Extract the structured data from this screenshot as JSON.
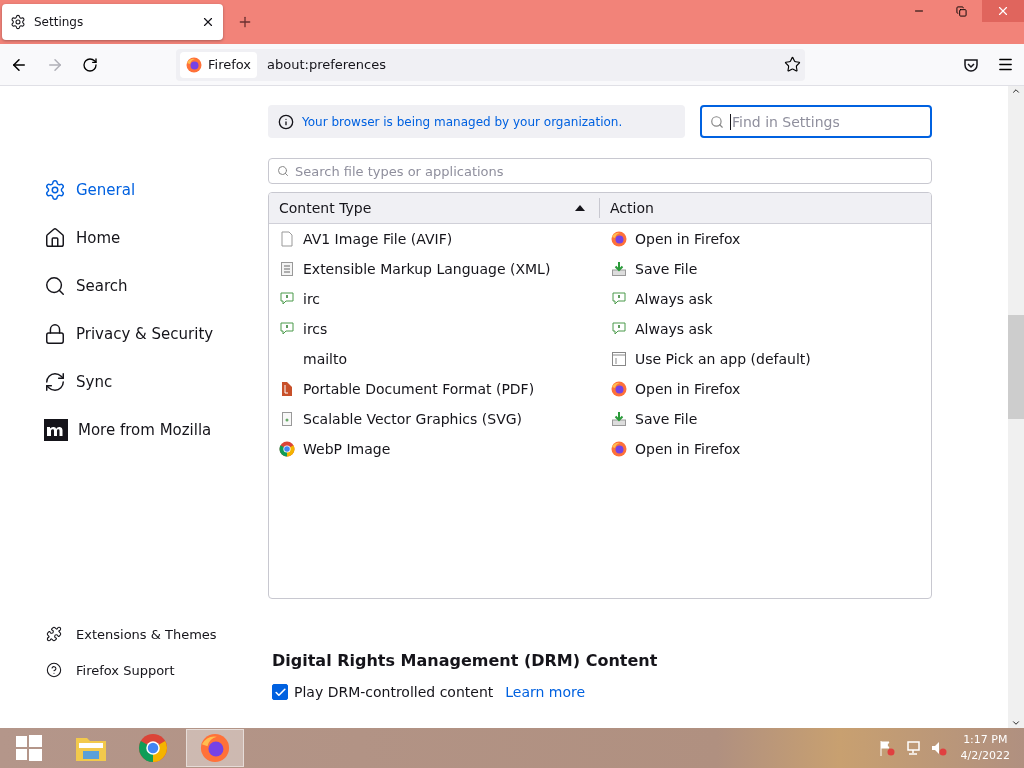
{
  "tab": {
    "title": "Settings",
    "selected": true
  },
  "address": {
    "identity": "Firefox",
    "url": "about:preferences"
  },
  "sidebar": {
    "items": [
      {
        "label": "General",
        "selected": true
      },
      {
        "label": "Home",
        "selected": false
      },
      {
        "label": "Search",
        "selected": false
      },
      {
        "label": "Privacy & Security",
        "selected": false
      },
      {
        "label": "Sync",
        "selected": false
      },
      {
        "label": "More from Mozilla",
        "selected": false
      }
    ],
    "footer": [
      {
        "label": "Extensions & Themes"
      },
      {
        "label": "Firefox Support"
      }
    ]
  },
  "notice": "Your browser is being managed by your organization.",
  "find": {
    "placeholder": "Find in Settings"
  },
  "type_search": {
    "placeholder": "Search file types or applications"
  },
  "table": {
    "columns": [
      "Content Type",
      "Action"
    ],
    "rows": [
      {
        "type": "AV1 Image File (AVIF)",
        "action": "Open in Firefox"
      },
      {
        "type": "Extensible Markup Language (XML)",
        "action": "Save File"
      },
      {
        "type": "irc",
        "action": "Always ask"
      },
      {
        "type": "ircs",
        "action": "Always ask"
      },
      {
        "type": "mailto",
        "action": "Use Pick an app (default)"
      },
      {
        "type": "Portable Document Format (PDF)",
        "action": "Open in Firefox"
      },
      {
        "type": "Scalable Vector Graphics (SVG)",
        "action": "Save File"
      },
      {
        "type": "WebP Image",
        "action": "Open in Firefox"
      }
    ]
  },
  "drm": {
    "heading": "Digital Rights Management (DRM) Content",
    "label": "Play DRM-controlled content",
    "checked": true,
    "link": "Learn more"
  },
  "taskbar": {
    "time": "1:17 PM",
    "date": "4/2/2022"
  }
}
